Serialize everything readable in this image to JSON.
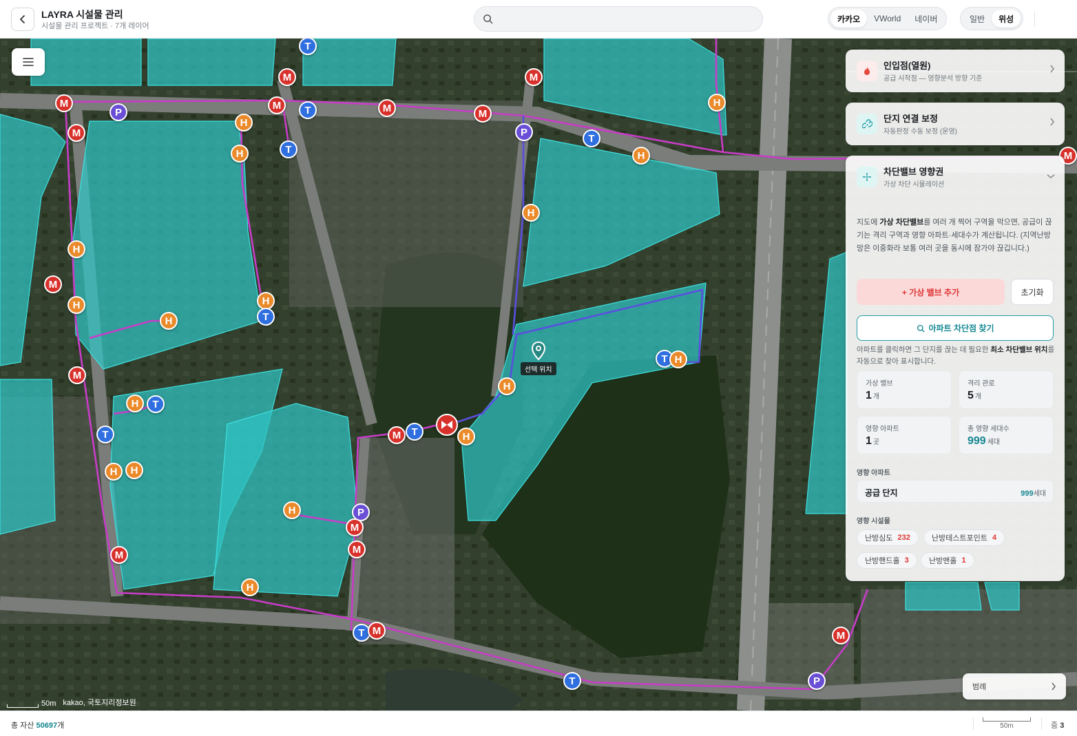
{
  "header": {
    "title": "LAYRA 시설물 관리",
    "subtitle": "시설물 관리 프로젝트 · 7개 레이어",
    "search_placeholder": "",
    "map_providers": [
      "카카오",
      "VWorld",
      "네이버"
    ],
    "map_provider_selected": "카카오",
    "map_types": [
      "일반",
      "위성"
    ],
    "map_type_selected": "위성"
  },
  "map": {
    "selected_location_label": "선택 위치",
    "attribution": "kakao, 국토지리정보원",
    "scale_label": "50m",
    "legend_label": "범례",
    "marker_letters": {
      "m": "M",
      "t": "T",
      "h": "H",
      "p": "P"
    },
    "colors": {
      "polygon": "#2fc4c4",
      "pipe": "#c83cc8",
      "valve": "#d8312c",
      "m": "#d8312c",
      "t": "#2f6fe0",
      "h": "#ea8a2a",
      "p": "#6a4fd6"
    }
  },
  "panel": {
    "source": {
      "title": "인입점(열원)",
      "subtitle": "공급 시작점 — 영향분석 방향 기준",
      "icon": "flame-icon"
    },
    "connection": {
      "title": "단지 연결 보정",
      "subtitle": "자동판정 수동 보정 (운영)",
      "icon": "link-icon"
    },
    "valve": {
      "title": "차단밸브 영향권",
      "subtitle": "가상 차단 시뮬레이션",
      "icon": "crosshair-icon",
      "desc_pre": "지도에 ",
      "desc_bold": "가상 차단밸브",
      "desc_post": "를 여러 개 찍어 구역을 막으면, 공급이 끊기는 격리 구역과 영향 아파트·세대수가 계산됩니다. (지역난방 망은 이중화라 보통 여러 곳을 동시에 잠가야 끊깁니다.)",
      "add_button": "+ 가상 밸브 추가",
      "reset_button": "초기화",
      "find_button": "아파트 차단점 찾기",
      "find_note_pre": "아파트를 클릭하면 그 단지를 끊는 데 필요한 ",
      "find_note_bold": "최소 차단밸브 위치",
      "find_note_post": "를 자동으로 찾아 표시합니다.",
      "stats": [
        {
          "label": "가상 밸브",
          "value": "1",
          "unit": "개"
        },
        {
          "label": "격리 관로",
          "value": "5",
          "unit": "개"
        },
        {
          "label": "영향 아파트",
          "value": "1",
          "unit": "곳"
        },
        {
          "label": "총 영향 세대수",
          "value": "999",
          "unit": "세대"
        }
      ],
      "affected_apartments_label": "영향 아파트",
      "apartment": {
        "name": "공급 단지",
        "count": "999",
        "unit": "세대"
      },
      "affected_facilities_label": "영향 시설물",
      "facilities": [
        {
          "name": "난방심도",
          "count": "232"
        },
        {
          "name": "난방테스트포인트",
          "count": "4"
        },
        {
          "name": "난방핸드홀",
          "count": "3"
        },
        {
          "name": "난방맨홀",
          "count": "1"
        }
      ]
    }
  },
  "footer": {
    "asset_label": "총 자산",
    "asset_count": "50697",
    "asset_unit": "개",
    "scale_label": "50m",
    "zoom_label": "줌",
    "zoom_value": "3"
  }
}
